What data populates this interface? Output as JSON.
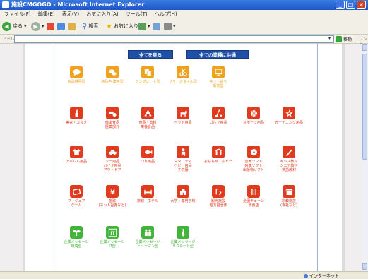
{
  "window": {
    "title": "施設CMGOGO - Microsoft Internet Explorer"
  },
  "menu": [
    "ファイル(F)",
    "編集(E)",
    "表示(V)",
    "お気に入り(A)",
    "ツール(T)",
    "ヘルプ(H)"
  ],
  "toolbar": {
    "back": "戻る",
    "search": "検索",
    "favorites": "お気に入り"
  },
  "address": {
    "label": "アドレス(D)",
    "value": "",
    "go": "移動",
    "links": "リンク"
  },
  "nav": {
    "all_label": "全てを見る",
    "common_label": "全ての業種に共通"
  },
  "colors": {
    "orange": "#f0a21e",
    "red": "#e03a1f",
    "green": "#43b43a",
    "nav_blue": "#1f50a7"
  },
  "rows": [
    {
      "color": "orange",
      "items": [
        {
          "label": "商品説明型",
          "icon": "speech-bubble-icon"
        },
        {
          "label": "商品名 連呼型",
          "icon": "chat-icon"
        },
        {
          "label": "テンプレート型",
          "icon": "copy-icon"
        },
        {
          "label": "フリースタイル型",
          "icon": "scissors-icon"
        },
        {
          "label": "ネット通り\n販売型",
          "icon": "monitor-icon"
        }
      ]
    },
    {
      "color": "red",
      "items": [
        {
          "label": "美容・コスメ",
          "icon": "lipstick-icon"
        },
        {
          "label": "健康食品\n医薬部外",
          "icon": "pills-icon"
        },
        {
          "label": "食品・飲料\n栄養食品",
          "icon": "riceball-icon"
        },
        {
          "label": "ペット用品",
          "icon": "dog-icon"
        },
        {
          "label": "ゴルフ用品",
          "icon": "golf-icon"
        },
        {
          "label": "スポーツ用品",
          "icon": "baseball-icon"
        },
        {
          "label": "ガーデニング用品",
          "icon": "flower-icon"
        }
      ]
    },
    {
      "color": "red",
      "items": [
        {
          "label": "アパレル用品",
          "icon": "tshirt-icon"
        },
        {
          "label": "カー用品\nバイク用品\nアウトドア",
          "icon": "car-icon"
        },
        {
          "label": "つり用品",
          "icon": "fish-icon"
        },
        {
          "label": "マタニティ\nベビー用品\n子供服",
          "icon": "baby-icon"
        },
        {
          "label": "おもちゃ・ホビー",
          "icon": "toy-icon"
        },
        {
          "label": "音楽ソフト\n映像ソフト\n出版物ソフト",
          "icon": "disc-icon"
        },
        {
          "label": "キッズ教材\nシニア教材\n英語教材",
          "icon": "pencil-icon"
        }
      ]
    },
    {
      "color": "red",
      "items": [
        {
          "label": "フィギュア\nゲーム",
          "icon": "game-icon"
        },
        {
          "label": "金融\n(ネット証券など)",
          "icon": "yen-icon"
        },
        {
          "label": "旅館・ホテル",
          "icon": "bed-icon"
        },
        {
          "label": "大学・専門学校",
          "icon": "school-icon"
        },
        {
          "label": "観光施設\n地方自治体",
          "icon": "gate-icon"
        },
        {
          "label": "全国チェーン\n飲食店",
          "icon": "restaurant-icon"
        },
        {
          "label": "宗教施設\n(寺社など)",
          "icon": "shrine-icon"
        }
      ]
    },
    {
      "color": "green",
      "items": [
        {
          "label": "企業メッセージ\n環境型",
          "icon": "sprout-icon"
        },
        {
          "label": "企業メッセージ\nIT型",
          "icon": "it-icon"
        },
        {
          "label": "企業メッセージ\nヒューマン型",
          "icon": "people-icon"
        },
        {
          "label": "企業メッセージ\nリクルート型",
          "icon": "tie-icon"
        }
      ]
    }
  ],
  "status": {
    "text": "",
    "zone": "インターネット"
  }
}
